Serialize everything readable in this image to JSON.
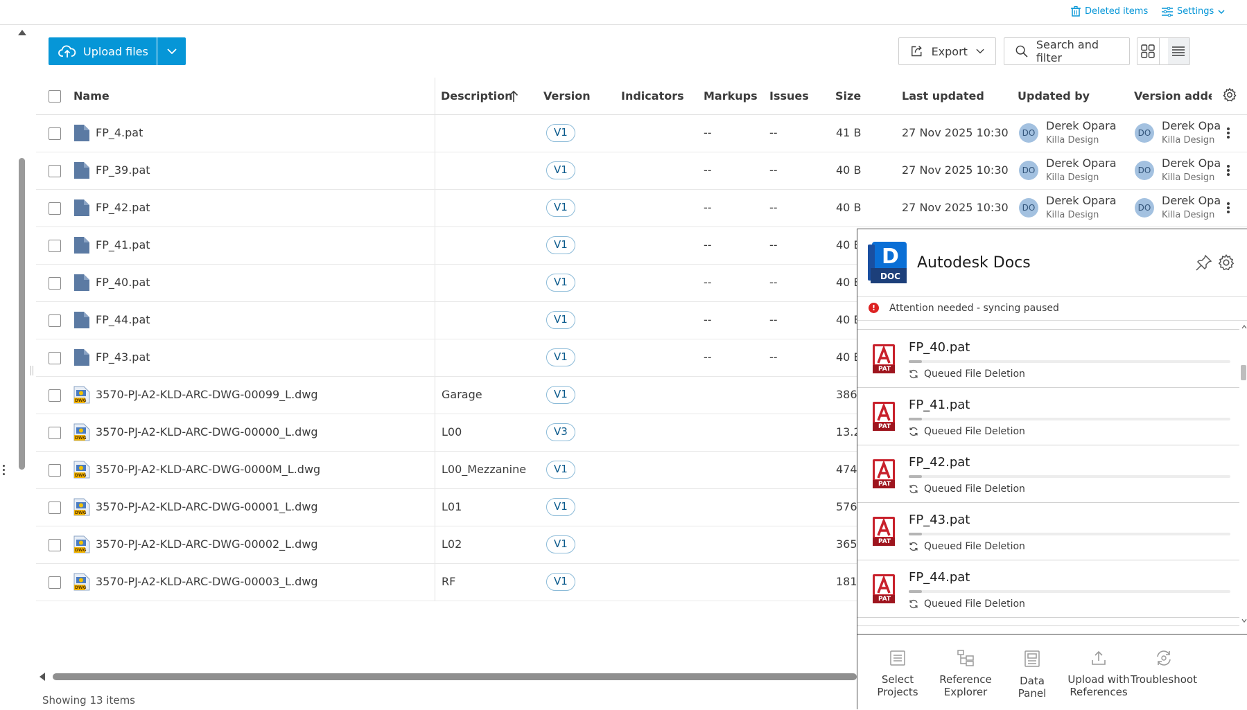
{
  "topbar": {
    "deleted_items": "Deleted items",
    "settings": "Settings"
  },
  "toolbar": {
    "upload_label": "Upload files",
    "export_label": "Export",
    "search_label": "Search and filter"
  },
  "table": {
    "columns": [
      "Name",
      "Description",
      "Version",
      "Indicators",
      "Markups",
      "Issues",
      "Size",
      "Last updated",
      "Updated by",
      "Version added"
    ],
    "rows": [
      {
        "name": "FP_4.pat",
        "desc": "",
        "ver": "V1",
        "markups": "--",
        "issues": "--",
        "size": "41 B",
        "updated": "27 Nov 2025 10:30",
        "by": "Derek Opara",
        "by_company": "Killa Design",
        "added": "Derek Opa",
        "added_company": "Killa Design",
        "type": "pat"
      },
      {
        "name": "FP_39.pat",
        "desc": "",
        "ver": "V1",
        "markups": "--",
        "issues": "--",
        "size": "40 B",
        "updated": "27 Nov 2025 10:30",
        "by": "Derek Opara",
        "by_company": "Killa Design",
        "added": "Derek Opa",
        "added_company": "Killa Design",
        "type": "pat"
      },
      {
        "name": "FP_42.pat",
        "desc": "",
        "ver": "V1",
        "markups": "--",
        "issues": "--",
        "size": "40 B",
        "updated": "27 Nov 2025 10:30",
        "by": "Derek Opara",
        "by_company": "Killa Design",
        "added": "Derek Opa",
        "added_company": "Killa Design",
        "type": "pat"
      },
      {
        "name": "FP_41.pat",
        "desc": "",
        "ver": "V1",
        "markups": "--",
        "issues": "--",
        "size": "40 E",
        "type": "pat"
      },
      {
        "name": "FP_40.pat",
        "desc": "",
        "ver": "V1",
        "markups": "--",
        "issues": "--",
        "size": "40 E",
        "type": "pat"
      },
      {
        "name": "FP_44.pat",
        "desc": "",
        "ver": "V1",
        "markups": "--",
        "issues": "--",
        "size": "40 E",
        "type": "pat"
      },
      {
        "name": "FP_43.pat",
        "desc": "",
        "ver": "V1",
        "markups": "--",
        "issues": "--",
        "size": "40 E",
        "type": "pat"
      },
      {
        "name": "3570-PJ-A2-KLD-ARC-DWG-00099_L.dwg",
        "desc": "Garage",
        "ver": "V1",
        "markups": "",
        "issues": "",
        "size": "386",
        "type": "dwg"
      },
      {
        "name": "3570-PJ-A2-KLD-ARC-DWG-00000_L.dwg",
        "desc": "L00",
        "ver": "V3",
        "markups": "",
        "issues": "",
        "size": "13.2",
        "type": "dwg"
      },
      {
        "name": "3570-PJ-A2-KLD-ARC-DWG-0000M_L.dwg",
        "desc": "L00_Mezzanine",
        "ver": "V1",
        "markups": "",
        "issues": "",
        "size": "474.",
        "type": "dwg"
      },
      {
        "name": "3570-PJ-A2-KLD-ARC-DWG-00001_L.dwg",
        "desc": "L01",
        "ver": "V1",
        "markups": "",
        "issues": "",
        "size": "576.",
        "type": "dwg"
      },
      {
        "name": "3570-PJ-A2-KLD-ARC-DWG-00002_L.dwg",
        "desc": "L02",
        "ver": "V1",
        "markups": "",
        "issues": "",
        "size": "365",
        "type": "dwg"
      },
      {
        "name": "3570-PJ-A2-KLD-ARC-DWG-00003_L.dwg",
        "desc": "RF",
        "ver": "V1",
        "markups": "",
        "issues": "",
        "size": "181.",
        "type": "dwg"
      }
    ],
    "avatar_initials": "DO",
    "showing": "Showing 13 items"
  },
  "panel": {
    "logo_letter": "D",
    "logo_sub": "DOC",
    "title": "Autodesk Docs",
    "attention_icon": "!",
    "attention": "Attention needed - syncing paused",
    "file_icon_sub": "PAT",
    "queue": [
      {
        "name": "FP_40.pat",
        "status": "Queued File Deletion",
        "progress": 0.04
      },
      {
        "name": "FP_41.pat",
        "status": "Queued File Deletion",
        "progress": 0.04
      },
      {
        "name": "FP_42.pat",
        "status": "Queued File Deletion",
        "progress": 0.04
      },
      {
        "name": "FP_43.pat",
        "status": "Queued File Deletion",
        "progress": 0.04
      },
      {
        "name": "FP_44.pat",
        "status": "Queued File Deletion",
        "progress": 0.04
      }
    ],
    "footer": [
      {
        "line1": "Select",
        "line2": "Projects",
        "icon": "list-icon"
      },
      {
        "line1": "Reference",
        "line2": "Explorer",
        "icon": "tree-icon"
      },
      {
        "line1": "Data",
        "line2": "Panel",
        "icon": "data-panel-icon"
      },
      {
        "line1": "Upload with",
        "line2": "References",
        "icon": "upload-icon"
      },
      {
        "line1": "Troubleshoot",
        "line2": "",
        "icon": "troubleshoot-icon"
      }
    ]
  },
  "colors": {
    "accent": "#0696d7",
    "version_border": "#8cbbd8",
    "file_blue": "#5b7aa3",
    "pat_red": "#c8202b",
    "alert_red": "#dd2222"
  }
}
